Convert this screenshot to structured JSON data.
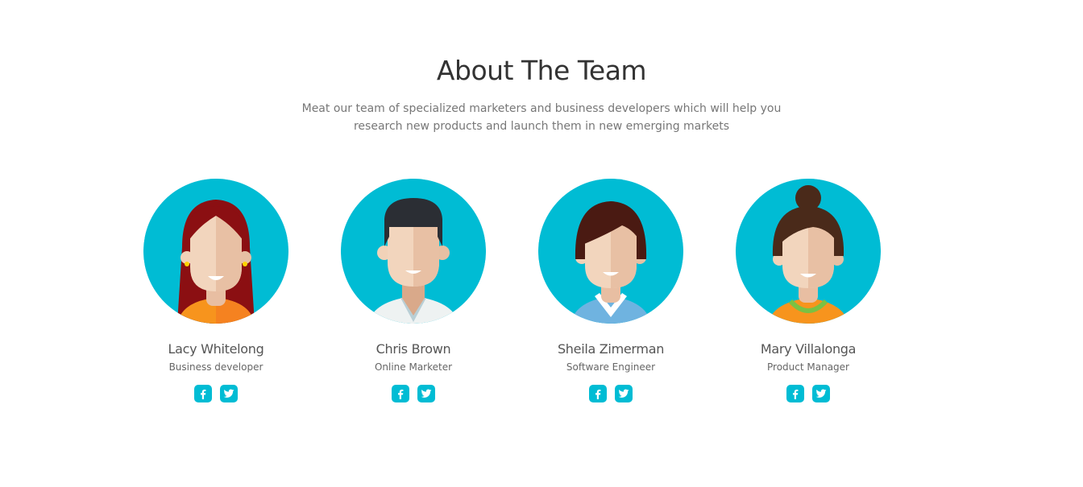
{
  "section": {
    "title": "About The Team",
    "subtitle_line1": "Meat our team of specialized marketers and business developers which will help you",
    "subtitle_line2": "research new products and launch them in new emerging markets"
  },
  "colors": {
    "accent": "#00bcd4",
    "title": "#333333",
    "text": "#777777"
  },
  "members": [
    {
      "name": "Lacy Whitelong",
      "role": "Business developer",
      "avatar_icon": "woman-long-red-hair-avatar",
      "socials": [
        "facebook-icon",
        "twitter-icon"
      ]
    },
    {
      "name": "Chris Brown",
      "role": "Online Marketer",
      "avatar_icon": "man-dark-hair-avatar",
      "socials": [
        "facebook-icon",
        "twitter-icon"
      ]
    },
    {
      "name": "Sheila Zimerman",
      "role": "Software Engineer",
      "avatar_icon": "woman-short-brown-hair-avatar",
      "socials": [
        "facebook-icon",
        "twitter-icon"
      ]
    },
    {
      "name": "Mary Villalonga",
      "role": "Product Manager",
      "avatar_icon": "woman-hair-bun-avatar",
      "socials": [
        "facebook-icon",
        "twitter-icon"
      ]
    }
  ]
}
